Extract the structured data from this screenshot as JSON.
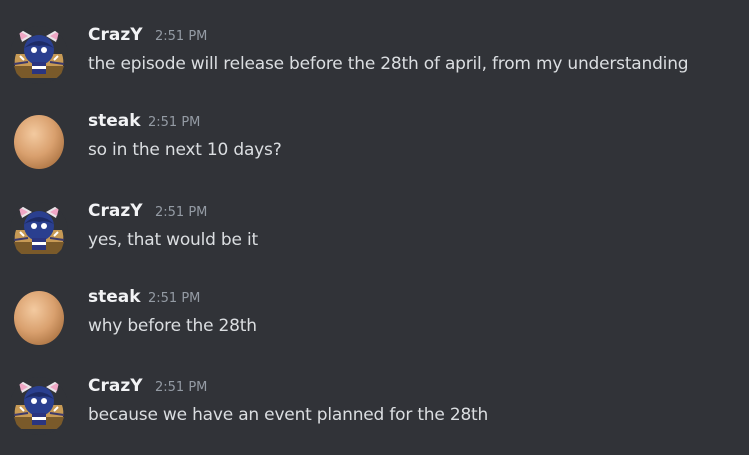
{
  "messages": [
    {
      "author": "CrazY",
      "time": "2:51 PM",
      "avatar": "crazy-avatar",
      "text": "the episode will release before the 28th of april, from my understanding"
    },
    {
      "author": "steak",
      "time": "2:51 PM",
      "avatar": "egg-avatar",
      "text": "so in the next 10 days?"
    },
    {
      "author": "CrazY",
      "time": "2:51 PM",
      "avatar": "crazy-avatar",
      "text": "yes, that would be it"
    },
    {
      "author": "steak",
      "time": "2:51 PM",
      "avatar": "egg-avatar",
      "text": "why before the 28th"
    },
    {
      "author": "CrazY",
      "time": "2:51 PM",
      "avatar": "crazy-avatar",
      "text": "because we have an event planned for the 28th"
    }
  ],
  "colors": {
    "background": "#313338",
    "username": "#f2f3f5",
    "timestamp": "#949ba4",
    "message_text": "#dbdee1"
  }
}
